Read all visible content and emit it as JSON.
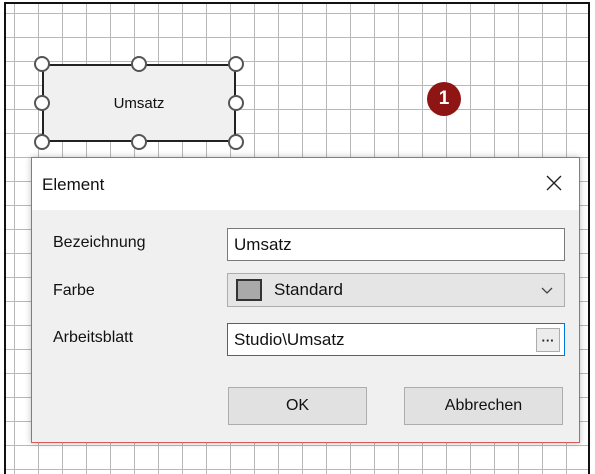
{
  "shape": {
    "label": "Umsatz"
  },
  "marker": {
    "number": "1"
  },
  "dialog": {
    "title": "Element",
    "fields": {
      "bezeichnung_label": "Bezeichnung",
      "bezeichnung_value": "Umsatz",
      "farbe_label": "Farbe",
      "farbe_value": "Standard",
      "farbe_swatch_color": "#a9a9a9",
      "arbeitsblatt_label": "Arbeitsblatt",
      "arbeitsblatt_value": "Studio\\Umsatz",
      "browse_label": "···"
    },
    "buttons": {
      "ok": "OK",
      "cancel": "Abbrechen"
    }
  },
  "colors": {
    "marker": "#8f1414",
    "dialog_border": "#d65a5a",
    "focus": "#0078d7"
  },
  "icons": [
    "close-icon",
    "chevron-down-icon"
  ]
}
